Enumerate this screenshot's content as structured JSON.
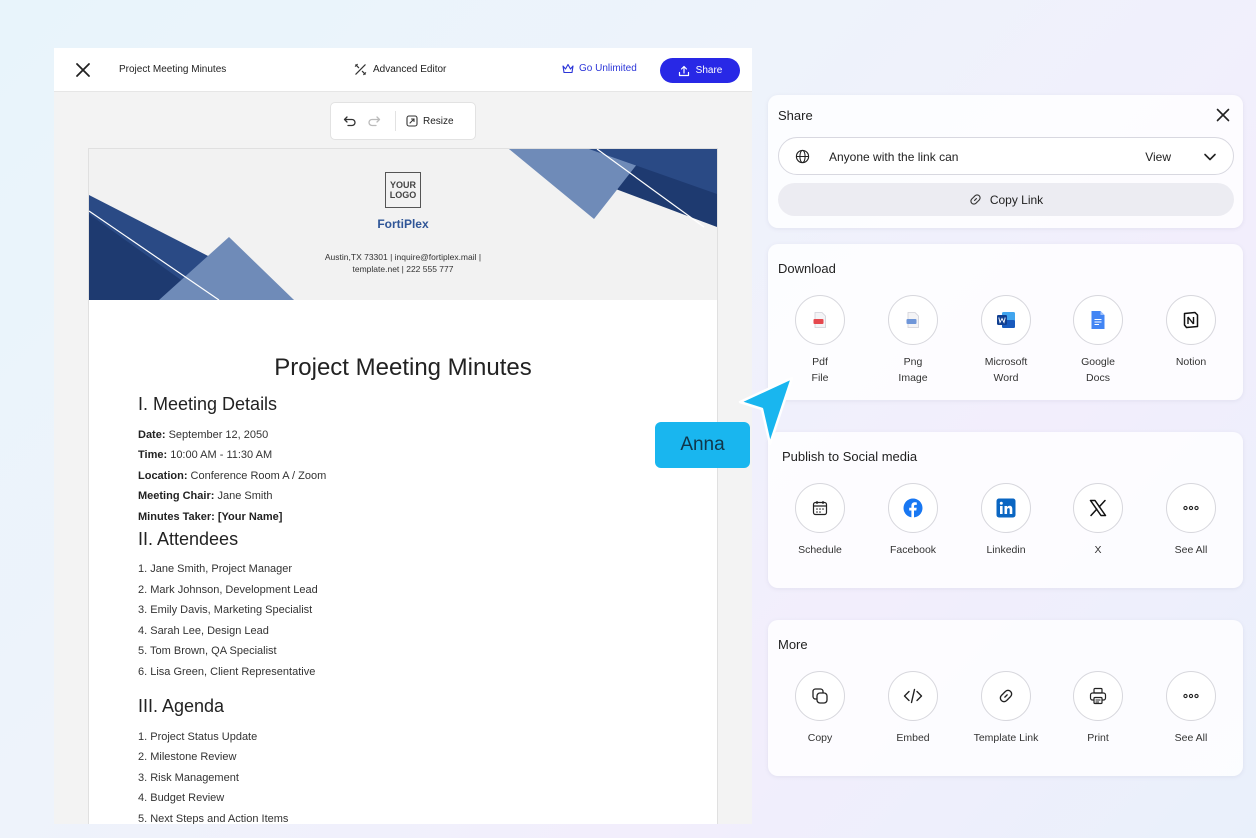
{
  "editor": {
    "doc_title": "Project Meeting Minutes",
    "advanced_editor": "Advanced Editor",
    "go_unlimited": "Go Unlimited",
    "share": "Share",
    "resize": "Resize"
  },
  "document": {
    "logo_line1": "YOUR",
    "logo_line2": "LOGO",
    "brand": "FortiPlex",
    "address_line1": "Austin,TX 73301 | inquire@fortiplex.mail |",
    "address_line2": "template.net | 222 555 777",
    "title": "Project Meeting Minutes",
    "section1": "I. Meeting Details",
    "details": [
      {
        "label": "Date:",
        "value": " September 12, 2050"
      },
      {
        "label": "Time:",
        "value": " 10:00 AM - 11:30 AM"
      },
      {
        "label": "Location:",
        "value": " Conference Room A / Zoom"
      },
      {
        "label": "Meeting Chair:",
        "value": " Jane Smith"
      },
      {
        "label": "Minutes Taker: [Your Name]",
        "value": ""
      }
    ],
    "section2": "II. Attendees",
    "attendees": [
      "1. Jane Smith, Project Manager",
      "2. Mark Johnson, Development Lead",
      "3. Emily Davis, Marketing Specialist",
      "4. Sarah Lee, Design Lead",
      "5. Tom Brown, QA Specialist",
      "6. Lisa Green, Client Representative"
    ],
    "section3": "III. Agenda",
    "agenda": [
      "1. Project Status Update",
      "2. Milestone Review",
      "3. Risk Management",
      "4. Budget Review",
      "5. Next Steps and Action Items"
    ]
  },
  "share_panel": {
    "title": "Share",
    "link_access": "Anyone with the link can",
    "permission": "View",
    "copy_link": "Copy Link"
  },
  "download_panel": {
    "title": "Download",
    "items": [
      {
        "line1": "Pdf",
        "line2": "File",
        "icon": "pdf-file-icon"
      },
      {
        "line1": "Png",
        "line2": "Image",
        "icon": "png-image-icon"
      },
      {
        "line1": "Microsoft",
        "line2": "Word",
        "icon": "microsoft-word-icon"
      },
      {
        "line1": "Google",
        "line2": "Docs",
        "icon": "google-docs-icon"
      },
      {
        "line1": "Notion",
        "line2": "",
        "icon": "notion-icon"
      }
    ]
  },
  "social_panel": {
    "title": "Publish to Social media",
    "items": [
      "Schedule",
      "Facebook",
      "Linkedin",
      "X",
      "See All"
    ]
  },
  "more_panel": {
    "title": "More",
    "items": [
      "Copy",
      "Embed",
      "Template Link",
      "Print",
      "See All"
    ]
  },
  "cursor": {
    "name": "Anna"
  },
  "colors": {
    "accent": "#2828e6",
    "brand_blue": "#2f5597",
    "cursor_blue": "#19b6ef"
  }
}
